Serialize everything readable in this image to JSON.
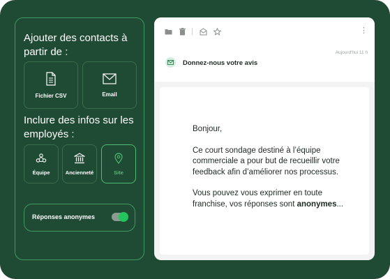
{
  "left": {
    "heading_contacts": "Ajouter des contacts à partir de :",
    "contact_sources": [
      {
        "label": "Fichier CSV",
        "icon": "document-icon"
      },
      {
        "label": "Email",
        "icon": "envelope-icon"
      }
    ],
    "heading_employees": "Inclure des infos sur les employés :",
    "employee_fields": [
      {
        "label": "Équipe",
        "icon": "team-icon",
        "selected": false
      },
      {
        "label": "Ancienneté",
        "icon": "building-icon",
        "selected": false
      },
      {
        "label": "Site",
        "icon": "location-pin-icon",
        "selected": true
      }
    ],
    "anonymous_label": "Réponses anonymes",
    "anonymous_enabled": true
  },
  "email": {
    "toolbar_icons": [
      "folder-icon",
      "trash-icon",
      "archive-icon",
      "star-icon",
      "more-icon"
    ],
    "timestamp": "Aujourd'hui 11 h",
    "subject": "Donnez-nous votre avis",
    "greeting": "Bonjour,",
    "paragraph1": "Ce court sondage destiné à l’équipe commerciale a pour but de recueillir votre feedback afin d’améliorer nos processus.",
    "paragraph2": "Vous pouvez vous exprimer en toute franchise, vos réponses sont",
    "paragraph2_bold": "anonymes",
    "paragraph2_end": "..."
  },
  "colors": {
    "background": "#1f4a33",
    "accent": "#4fbb74",
    "toggle_on": "#22c55e"
  }
}
